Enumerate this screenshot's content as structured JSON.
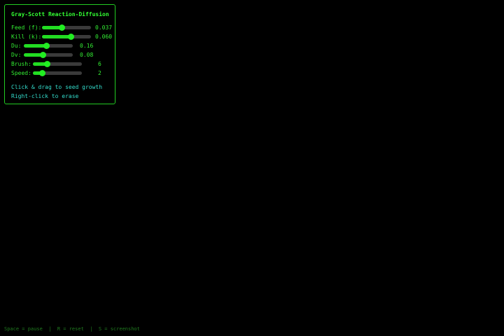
{
  "panel": {
    "title": "Gray-Scott Reaction-Diffusion",
    "controls": [
      {
        "id": "feed",
        "label": "Feed (f):",
        "value_text": "0.037",
        "fraction": 0.4
      },
      {
        "id": "kill",
        "label": "Kill (k):",
        "value_text": "0.060",
        "fraction": 0.59
      },
      {
        "id": "du",
        "label": "Du:",
        "value_text": "0.16",
        "fraction": 0.45
      },
      {
        "id": "dv",
        "label": "Dv:",
        "value_text": "0.08",
        "fraction": 0.38
      },
      {
        "id": "brush",
        "label": "Brush:",
        "value_text": "6",
        "fraction": 0.29
      },
      {
        "id": "speed",
        "label": "Speed:",
        "value_text": "2",
        "fraction": 0.19
      }
    ],
    "hints": {
      "draw": "Click & drag to seed growth",
      "erase": "Right-click to erase"
    }
  },
  "footer": {
    "text": "Space = pause  |  R = reset  |  S = screenshot"
  },
  "colors": {
    "background": "#000000",
    "accent": "#22dd22",
    "hint": "#33ddcc",
    "footer": "#1f7a1f"
  }
}
